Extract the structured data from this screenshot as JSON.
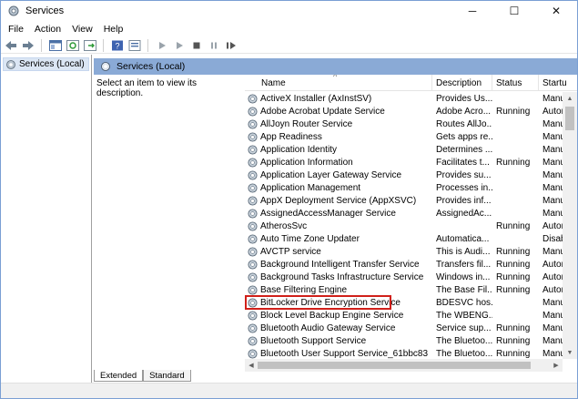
{
  "window": {
    "title": "Services",
    "minimize": "─",
    "maximize": "☐",
    "close": "✕"
  },
  "menu": [
    "File",
    "Action",
    "View",
    "Help"
  ],
  "tree": {
    "root": "Services (Local)"
  },
  "header": {
    "title": "Services (Local)"
  },
  "description_panel": {
    "text": "Select an item to view its description."
  },
  "columns": {
    "name": "Name",
    "description": "Description",
    "status": "Status",
    "startup": "Startu"
  },
  "rows": [
    {
      "name": "ActiveX Installer (AxInstSV)",
      "description": "Provides Us...",
      "status": "",
      "startup": "Manu"
    },
    {
      "name": "Adobe Acrobat Update Service",
      "description": "Adobe Acro...",
      "status": "Running",
      "startup": "Auton"
    },
    {
      "name": "AllJoyn Router Service",
      "description": "Routes AllJo...",
      "status": "",
      "startup": "Manu"
    },
    {
      "name": "App Readiness",
      "description": "Gets apps re...",
      "status": "",
      "startup": "Manu"
    },
    {
      "name": "Application Identity",
      "description": "Determines ...",
      "status": "",
      "startup": "Manu"
    },
    {
      "name": "Application Information",
      "description": "Facilitates t...",
      "status": "Running",
      "startup": "Manu"
    },
    {
      "name": "Application Layer Gateway Service",
      "description": "Provides su...",
      "status": "",
      "startup": "Manu"
    },
    {
      "name": "Application Management",
      "description": "Processes in...",
      "status": "",
      "startup": "Manu"
    },
    {
      "name": "AppX Deployment Service (AppXSVC)",
      "description": "Provides inf...",
      "status": "",
      "startup": "Manu"
    },
    {
      "name": "AssignedAccessManager Service",
      "description": "AssignedAc...",
      "status": "",
      "startup": "Manu"
    },
    {
      "name": "AtherosSvc",
      "description": "",
      "status": "Running",
      "startup": "Auton"
    },
    {
      "name": "Auto Time Zone Updater",
      "description": "Automatica...",
      "status": "",
      "startup": "Disab"
    },
    {
      "name": "AVCTP service",
      "description": "This is Audi...",
      "status": "Running",
      "startup": "Manu"
    },
    {
      "name": "Background Intelligent Transfer Service",
      "description": "Transfers fil...",
      "status": "Running",
      "startup": "Auton"
    },
    {
      "name": "Background Tasks Infrastructure Service",
      "description": "Windows in...",
      "status": "Running",
      "startup": "Auton"
    },
    {
      "name": "Base Filtering Engine",
      "description": "The Base Fil...",
      "status": "Running",
      "startup": "Auton"
    },
    {
      "name": "BitLocker Drive Encryption Service",
      "description": "BDESVC hos...",
      "status": "",
      "startup": "Manu"
    },
    {
      "name": "Block Level Backup Engine Service",
      "description": "The WBENG...",
      "status": "",
      "startup": "Manu"
    },
    {
      "name": "Bluetooth Audio Gateway Service",
      "description": "Service sup...",
      "status": "Running",
      "startup": "Manu"
    },
    {
      "name": "Bluetooth Support Service",
      "description": "The Bluetoo...",
      "status": "Running",
      "startup": "Manu"
    },
    {
      "name": "Bluetooth User Support Service_61bbc83",
      "description": "The Bluetoo...",
      "status": "Running",
      "startup": "Manu"
    }
  ],
  "highlighted_row": "BitLocker Drive Encryption Service",
  "tabs": [
    "Extended",
    "Standard"
  ],
  "colors": {
    "header_bar": "#8aaad6",
    "highlight_border": "#d0201a",
    "selection": "#dbe6f4"
  }
}
